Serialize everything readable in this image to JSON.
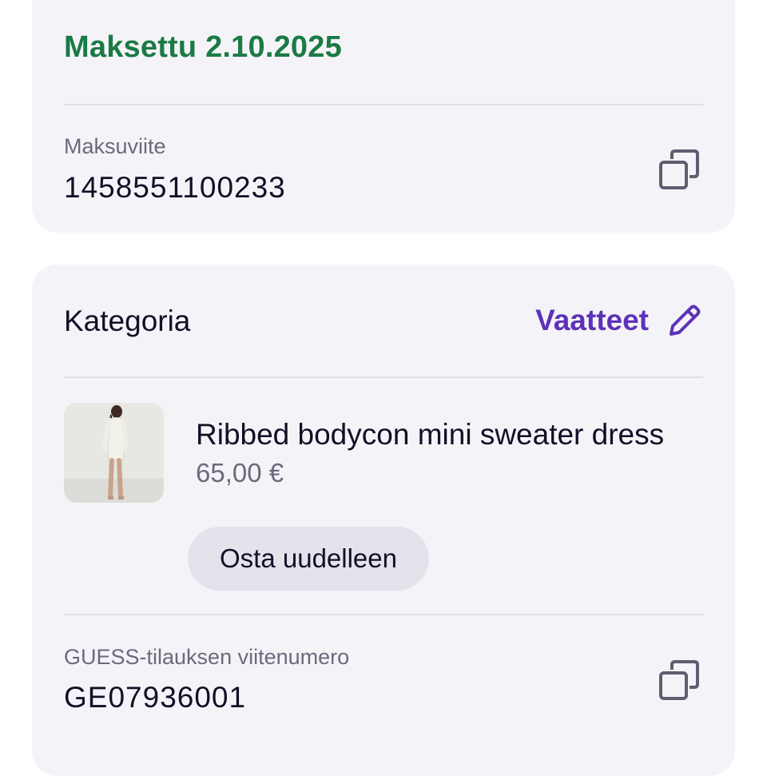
{
  "payment": {
    "status": "Maksettu 2.10.2025",
    "reference_label": "Maksuviite",
    "reference_value": "1458551100233"
  },
  "category": {
    "label": "Kategoria",
    "value": "Vaatteet"
  },
  "product": {
    "name": "Ribbed bodycon mini sweater dress",
    "price": "65,00 €",
    "buy_again_label": "Osta uudelleen"
  },
  "order": {
    "reference_label": "GUESS-tilauksen viitenumero",
    "reference_value": "GE07936001"
  },
  "colors": {
    "paid_green": "#1b7a45",
    "accent_purple": "#5d32b8",
    "card_background": "#f4f4f8"
  },
  "icons": {
    "copy": "copy-icon",
    "edit": "pencil-icon"
  }
}
